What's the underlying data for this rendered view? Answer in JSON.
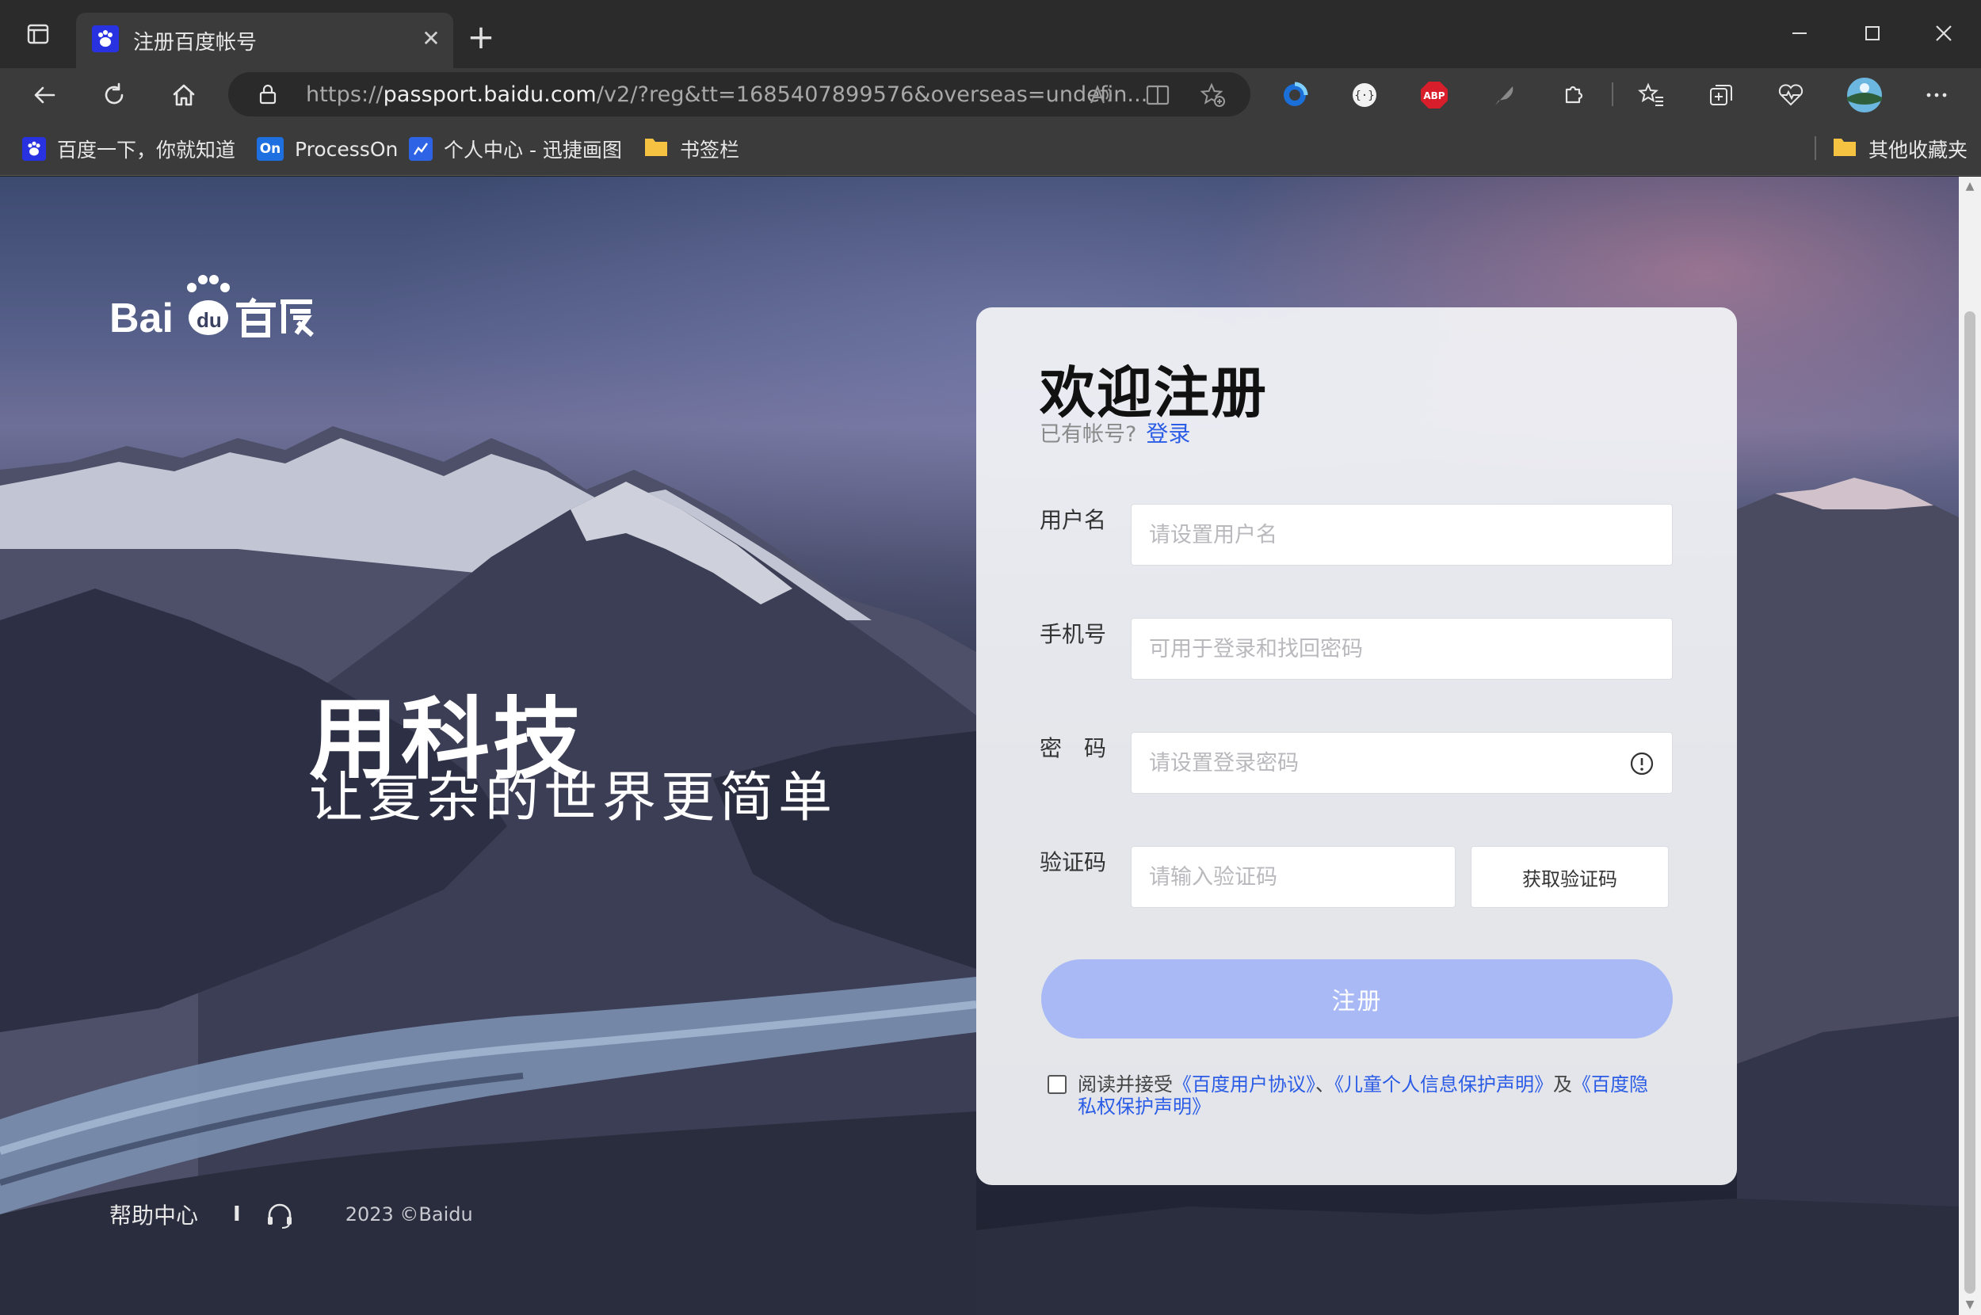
{
  "browser": {
    "tab_title": "注册百度帐号",
    "url_prefix": "https://",
    "url_host": "passport.baidu.com",
    "url_path": "/v2/?reg&tt=1685407899576&overseas=undefin...",
    "bookmarks": [
      {
        "label": "百度一下，你就知道",
        "icon": "baidu-paw-icon"
      },
      {
        "label": "ProcessOn",
        "icon": "processon-icon",
        "icon_text": "On"
      },
      {
        "label": "个人中心 - 迅捷画图",
        "icon": "chart-icon"
      },
      {
        "label": "书签栏",
        "icon": "folder-icon"
      }
    ],
    "other_bookmarks": "其他收藏夹",
    "extension_abp_text": "ABP"
  },
  "page": {
    "slogan_main": "用科技",
    "slogan_sub": "让复杂的世界更简单",
    "footer": {
      "help": "帮助中心",
      "separator": "I",
      "copyright": "2023 ©Baidu"
    }
  },
  "form": {
    "title": "欢迎注册",
    "login_prompt": "已有帐号?",
    "login_link": "登录",
    "username_label": "用户名",
    "username_placeholder": "请设置用户名",
    "phone_label": "手机号",
    "phone_placeholder": "可用于登录和找回密码",
    "password_label": "密　码",
    "password_placeholder": "请设置登录密码",
    "code_label": "验证码",
    "code_placeholder": "请输入验证码",
    "get_code": "获取验证码",
    "submit": "注册",
    "agree_prefix": "阅读并接受",
    "agree_link_1": "《百度用户协议》",
    "agree_sep_1": "、",
    "agree_link_2": "《儿童个人信息保护声明》",
    "agree_sep_2": "及",
    "agree_link_3": "《百度隐私权保护声明》"
  },
  "colors": {
    "accent": "#2b5ce6",
    "register_button": "#a8b9f5",
    "chrome_dark": "#2b2b2b",
    "chrome_mid": "#3b3b3b"
  }
}
